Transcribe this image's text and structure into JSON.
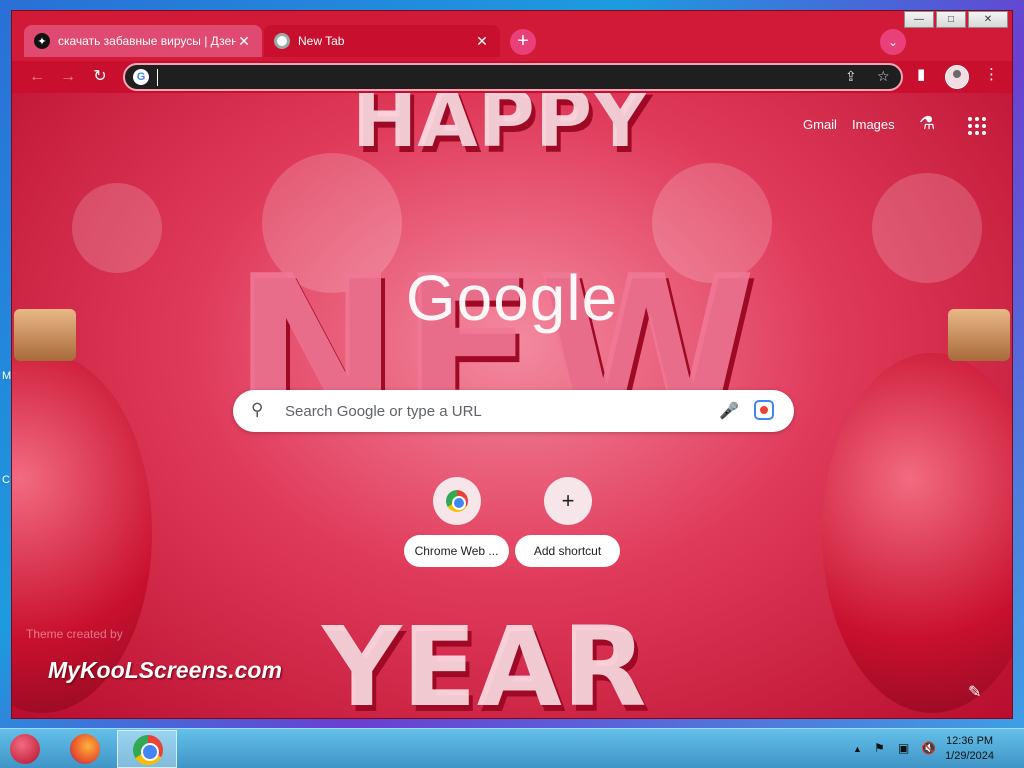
{
  "desktop": {
    "edge_letters": [
      "M",
      "C"
    ]
  },
  "window": {
    "controls": {
      "minimize": "—",
      "maximize": "□",
      "close": "✕"
    }
  },
  "tabs": [
    {
      "title": "скачать забавные вирусы | Дзен",
      "close": "✕"
    },
    {
      "title": "New Tab",
      "close": "✕"
    }
  ],
  "toolbar": {
    "new_tab": "+",
    "tab_search": "⌄",
    "back": "←",
    "forward": "→",
    "reload": "↻",
    "omnibox_value": "",
    "share": "⇪",
    "star": "☆",
    "side_panel": "▮",
    "menu": "⋮"
  },
  "ntp": {
    "links": {
      "gmail": "Gmail",
      "images": "Images"
    },
    "logo": "Google",
    "search_placeholder": "Search Google or type a URL",
    "shortcuts": [
      {
        "label": "Chrome Web ...",
        "icon": "chrome-web-store-icon"
      },
      {
        "label": "Add shortcut",
        "icon": "plus-icon",
        "glyph": "+"
      }
    ],
    "theme_credit": "Theme created by",
    "theme_brand": "MyKooLScreens.com",
    "theme_decor": {
      "top": "HAPPY",
      "middle": "NEW",
      "bottom": "YEAR"
    }
  },
  "taskbar": {
    "tray": {
      "up_arrow": "▲",
      "flag": "⚑",
      "network": "▣",
      "volume": "🔇"
    },
    "clock": {
      "time": "12:36 PM",
      "date": "1/29/2024"
    }
  },
  "colors": {
    "frame": "#c8102e",
    "tab_inactive": "#e14a70",
    "omnibox": "#1f1f1f",
    "taskbar": "#4fa8d6"
  }
}
